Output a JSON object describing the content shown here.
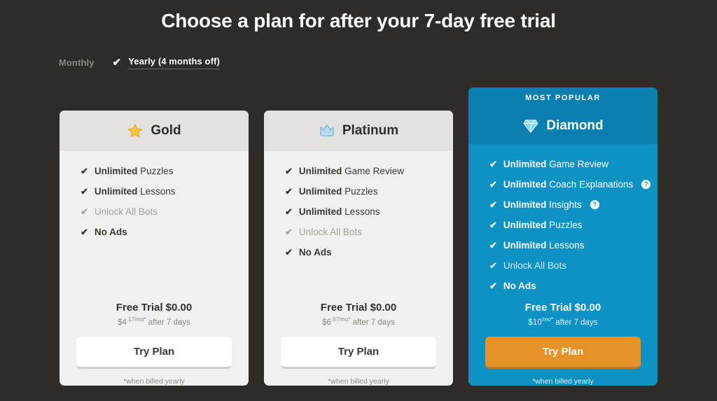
{
  "page": {
    "title": "Choose a plan for after your 7-day free trial",
    "background_color": "#2e2b29"
  },
  "billing": {
    "monthly_label": "Monthly",
    "yearly_label": "Yearly (4 months off)",
    "selected": "yearly",
    "check_icon": "✔"
  },
  "colors": {
    "accent_blue": "#0e92c4",
    "accent_blue_dark": "#0a7fb0",
    "cta_orange": "#e79227",
    "card_gray": "#f0f0f0",
    "card_header_gray": "#e3e1df"
  },
  "plans": [
    {
      "id": "gold",
      "name": "Gold",
      "icon": "star-icon",
      "featured": false,
      "badge": null,
      "features": [
        {
          "strong": "Unlimited",
          "rest": " Puzzles",
          "muted": false,
          "help": false
        },
        {
          "strong": "Unlimited",
          "rest": " Lessons",
          "muted": false,
          "help": false
        },
        {
          "strong": "",
          "rest": "Unlock All Bots",
          "muted": true,
          "help": false
        },
        {
          "strong": "No Ads",
          "rest": "",
          "muted": false,
          "help": false
        }
      ],
      "price_main": "Free Trial $0.00",
      "price_currency": "$4",
      "price_sup": ".17/mo*",
      "price_after": " after 7 days",
      "cta_label": "Try Plan",
      "billed_note": "*when billed yearly"
    },
    {
      "id": "platinum",
      "name": "Platinum",
      "icon": "crown-icon",
      "featured": false,
      "badge": null,
      "features": [
        {
          "strong": "Unlimited",
          "rest": " Game Review",
          "muted": false,
          "help": false
        },
        {
          "strong": "Unlimited",
          "rest": " Puzzles",
          "muted": false,
          "help": false
        },
        {
          "strong": "Unlimited",
          "rest": " Lessons",
          "muted": false,
          "help": false
        },
        {
          "strong": "",
          "rest": "Unlock All Bots",
          "muted": true,
          "help": false
        },
        {
          "strong": "No Ads",
          "rest": "",
          "muted": false,
          "help": false
        }
      ],
      "price_main": "Free Trial $0.00",
      "price_currency": "$6",
      "price_sup": ".67/mo*",
      "price_after": " after 7 days",
      "cta_label": "Try Plan",
      "billed_note": "*when billed yearly"
    },
    {
      "id": "diamond",
      "name": "Diamond",
      "icon": "diamond-icon",
      "featured": true,
      "badge": "MOST POPULAR",
      "features": [
        {
          "strong": "Unlimited",
          "rest": " Game Review",
          "muted": false,
          "help": false
        },
        {
          "strong": "Unlimited",
          "rest": " Coach Explanations",
          "muted": false,
          "help": true
        },
        {
          "strong": "Unlimited",
          "rest": " Insights",
          "muted": false,
          "help": true
        },
        {
          "strong": "Unlimited",
          "rest": " Puzzles",
          "muted": false,
          "help": false
        },
        {
          "strong": "Unlimited",
          "rest": " Lessons",
          "muted": false,
          "help": false
        },
        {
          "strong": "",
          "rest": "Unlock All Bots",
          "muted": true,
          "help": false
        },
        {
          "strong": "No Ads",
          "rest": "",
          "muted": false,
          "help": false
        }
      ],
      "price_main": "Free Trial $0.00",
      "price_currency": "$10",
      "price_sup": "/mo*",
      "price_after": " after 7 days",
      "cta_label": "Try Plan",
      "billed_note": "*when billed yearly"
    }
  ],
  "icons": {
    "tick": "✔",
    "help": "?"
  }
}
